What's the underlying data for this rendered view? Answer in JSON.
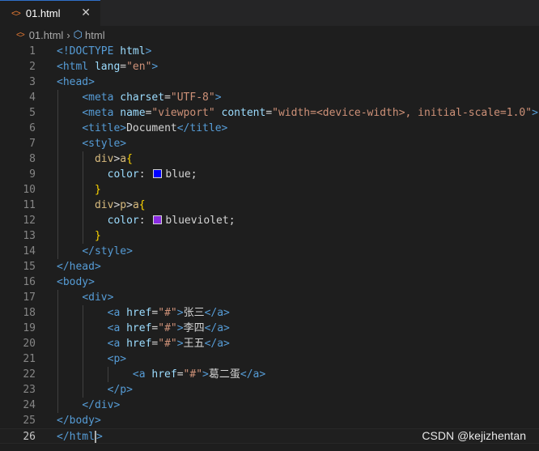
{
  "tab": {
    "icon": "html-file-icon",
    "label": "01.html",
    "close": "✕"
  },
  "breadcrumb": {
    "file": "01.html",
    "symbol": "html"
  },
  "editor": {
    "current_line": 26,
    "lines": [
      {
        "n": "1",
        "tokens": [
          [
            "t-tag",
            "<!DOCTYPE "
          ],
          [
            "t-attr",
            "html"
          ],
          [
            "t-tag",
            ">"
          ]
        ]
      },
      {
        "n": "2",
        "tokens": [
          [
            "t-tag",
            "<html "
          ],
          [
            "t-attr",
            "lang"
          ],
          [
            "t-txt",
            "="
          ],
          [
            "t-str",
            "\"en\""
          ],
          [
            "t-tag",
            ">"
          ]
        ]
      },
      {
        "n": "3",
        "tokens": [
          [
            "t-tag",
            "<head>"
          ]
        ]
      },
      {
        "n": "4",
        "tokens": [
          [
            "t-txt",
            "    "
          ],
          [
            "t-tag",
            "<meta "
          ],
          [
            "t-attr",
            "charset"
          ],
          [
            "t-txt",
            "="
          ],
          [
            "t-str",
            "\"UTF-8\""
          ],
          [
            "t-tag",
            ">"
          ]
        ]
      },
      {
        "n": "5",
        "tokens": [
          [
            "t-txt",
            "    "
          ],
          [
            "t-tag",
            "<meta "
          ],
          [
            "t-attr",
            "name"
          ],
          [
            "t-txt",
            "="
          ],
          [
            "t-str",
            "\"viewport\""
          ],
          [
            "t-txt",
            " "
          ],
          [
            "t-attr",
            "content"
          ],
          [
            "t-txt",
            "="
          ],
          [
            "t-str",
            "\"width=<device-width>, initial-scale=1.0\""
          ],
          [
            "t-tag",
            ">"
          ]
        ]
      },
      {
        "n": "6",
        "tokens": [
          [
            "t-txt",
            "    "
          ],
          [
            "t-tag",
            "<title>"
          ],
          [
            "t-txt",
            "Document"
          ],
          [
            "t-tag",
            "</title>"
          ]
        ]
      },
      {
        "n": "7",
        "tokens": [
          [
            "t-txt",
            "    "
          ],
          [
            "t-tag",
            "<style>"
          ]
        ]
      },
      {
        "n": "8",
        "tokens": [
          [
            "t-txt",
            "      "
          ],
          [
            "t-sel",
            "div"
          ],
          [
            "t-txt",
            ">"
          ],
          [
            "t-sel",
            "a"
          ],
          [
            "t-brace",
            "{"
          ]
        ]
      },
      {
        "n": "9",
        "tokens": [
          [
            "t-txt",
            "        "
          ],
          [
            "t-prop",
            "color"
          ],
          [
            "t-txt",
            ": "
          ],
          [
            "swatch",
            "#0000ff"
          ],
          [
            "t-val",
            "blue"
          ],
          [
            "t-txt",
            ";"
          ]
        ]
      },
      {
        "n": "10",
        "tokens": [
          [
            "t-txt",
            "      "
          ],
          [
            "t-brace",
            "}"
          ]
        ]
      },
      {
        "n": "11",
        "tokens": [
          [
            "t-txt",
            "      "
          ],
          [
            "t-sel",
            "div"
          ],
          [
            "t-txt",
            ">"
          ],
          [
            "t-sel",
            "p"
          ],
          [
            "t-txt",
            ">"
          ],
          [
            "t-sel",
            "a"
          ],
          [
            "t-brace",
            "{"
          ]
        ]
      },
      {
        "n": "12",
        "tokens": [
          [
            "t-txt",
            "        "
          ],
          [
            "t-prop",
            "color"
          ],
          [
            "t-txt",
            ": "
          ],
          [
            "swatch",
            "#8a2be2"
          ],
          [
            "t-val",
            "blueviolet"
          ],
          [
            "t-txt",
            ";"
          ]
        ]
      },
      {
        "n": "13",
        "tokens": [
          [
            "t-txt",
            "      "
          ],
          [
            "t-brace",
            "}"
          ]
        ]
      },
      {
        "n": "14",
        "tokens": [
          [
            "t-txt",
            "    "
          ],
          [
            "t-tag",
            "</style>"
          ]
        ]
      },
      {
        "n": "15",
        "tokens": [
          [
            "t-tag",
            "</head>"
          ]
        ]
      },
      {
        "n": "16",
        "tokens": [
          [
            "t-tag",
            "<body>"
          ]
        ]
      },
      {
        "n": "17",
        "tokens": [
          [
            "t-txt",
            "    "
          ],
          [
            "t-tag",
            "<div>"
          ]
        ]
      },
      {
        "n": "18",
        "tokens": [
          [
            "t-txt",
            "        "
          ],
          [
            "t-tag",
            "<a "
          ],
          [
            "t-attr",
            "href"
          ],
          [
            "t-txt",
            "="
          ],
          [
            "t-str",
            "\"#\""
          ],
          [
            "t-tag",
            ">"
          ],
          [
            "t-txt",
            "张三"
          ],
          [
            "t-tag",
            "</a>"
          ]
        ]
      },
      {
        "n": "19",
        "tokens": [
          [
            "t-txt",
            "        "
          ],
          [
            "t-tag",
            "<a "
          ],
          [
            "t-attr",
            "href"
          ],
          [
            "t-txt",
            "="
          ],
          [
            "t-str",
            "\"#\""
          ],
          [
            "t-tag",
            ">"
          ],
          [
            "t-txt",
            "李四"
          ],
          [
            "t-tag",
            "</a>"
          ]
        ]
      },
      {
        "n": "20",
        "tokens": [
          [
            "t-txt",
            "        "
          ],
          [
            "t-tag",
            "<a "
          ],
          [
            "t-attr",
            "href"
          ],
          [
            "t-txt",
            "="
          ],
          [
            "t-str",
            "\"#\""
          ],
          [
            "t-tag",
            ">"
          ],
          [
            "t-txt",
            "王五"
          ],
          [
            "t-tag",
            "</a>"
          ]
        ]
      },
      {
        "n": "21",
        "tokens": [
          [
            "t-txt",
            "        "
          ],
          [
            "t-tag",
            "<p>"
          ]
        ]
      },
      {
        "n": "22",
        "tokens": [
          [
            "t-txt",
            "            "
          ],
          [
            "t-tag",
            "<a "
          ],
          [
            "t-attr",
            "href"
          ],
          [
            "t-txt",
            "="
          ],
          [
            "t-str",
            "\"#\""
          ],
          [
            "t-tag",
            ">"
          ],
          [
            "t-txt",
            "葛二蛋"
          ],
          [
            "t-tag",
            "</a>"
          ]
        ]
      },
      {
        "n": "23",
        "tokens": [
          [
            "t-txt",
            "        "
          ],
          [
            "t-tag",
            "</p>"
          ]
        ]
      },
      {
        "n": "24",
        "tokens": [
          [
            "t-txt",
            "    "
          ],
          [
            "t-tag",
            "</div>"
          ]
        ]
      },
      {
        "n": "25",
        "tokens": [
          [
            "t-tag",
            "</body>"
          ]
        ]
      },
      {
        "n": "26",
        "tokens": [
          [
            "t-tag",
            "</html"
          ],
          [
            "cursor",
            ""
          ],
          [
            "t-tag",
            ">"
          ]
        ]
      }
    ]
  },
  "watermark": "CSDN @kejizhentan"
}
